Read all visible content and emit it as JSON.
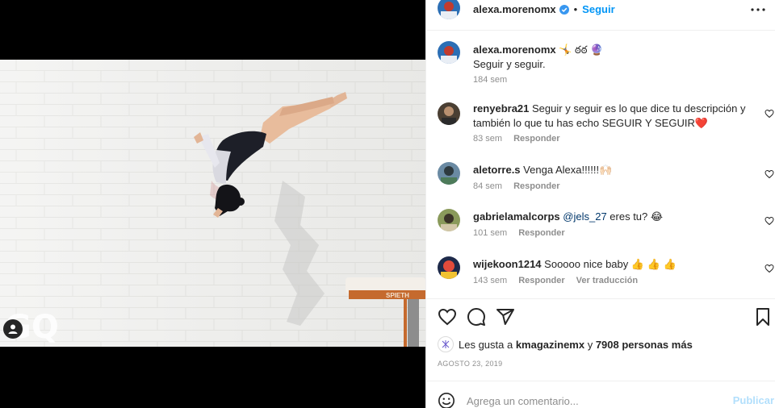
{
  "post": {
    "author": "alexa.morenomx",
    "follow_label": "Seguir",
    "separator": "•",
    "caption_emojis": "🤸 ఠఠ 🔮",
    "caption_text": "Seguir y seguir.",
    "caption_time": "184 sem",
    "watermark": "GQ",
    "bar_brand": "SPIETH"
  },
  "comments": [
    {
      "user": "renyebra21",
      "text": "Seguir y seguir es lo que dice tu descripción y también lo que tu has echo SEGUIR Y SEGUIR❤️",
      "time": "83 sem",
      "reply": "Responder",
      "translate": ""
    },
    {
      "user": "aletorre.s",
      "text": "Venga Alexa!!!!!!🙌🏻",
      "time": "84 sem",
      "reply": "Responder",
      "translate": ""
    },
    {
      "user": "gabrielamalcorps",
      "mention": "@jels_27",
      "text": " eres tu? 😂",
      "time": "101 sem",
      "reply": "Responder",
      "translate": ""
    },
    {
      "user": "wijekoon1214",
      "text": "Sooooo nice baby 👍 👍 👍",
      "time": "143 sem",
      "reply": "Responder",
      "translate": "Ver traducción"
    }
  ],
  "likes": {
    "prefix": "Les gusta a ",
    "user": "kmagazinemx",
    "middle": " y ",
    "others": "7908 personas más"
  },
  "date": "AGOSTO 23, 2019",
  "add_comment": {
    "placeholder": "Agrega un comentario...",
    "publish": "Publicar"
  },
  "icons": {
    "like": "heart-icon",
    "comment": "comment-icon",
    "share": "paper-plane-icon",
    "save": "bookmark-icon",
    "emoji": "smile-icon",
    "more": "ellipsis-icon",
    "tag": "user-tag-icon"
  },
  "colors": {
    "accent": "#0095f6",
    "verified": "#3897f0",
    "muted": "#8e8e8e",
    "publish_disabled": "#b2dffc"
  }
}
